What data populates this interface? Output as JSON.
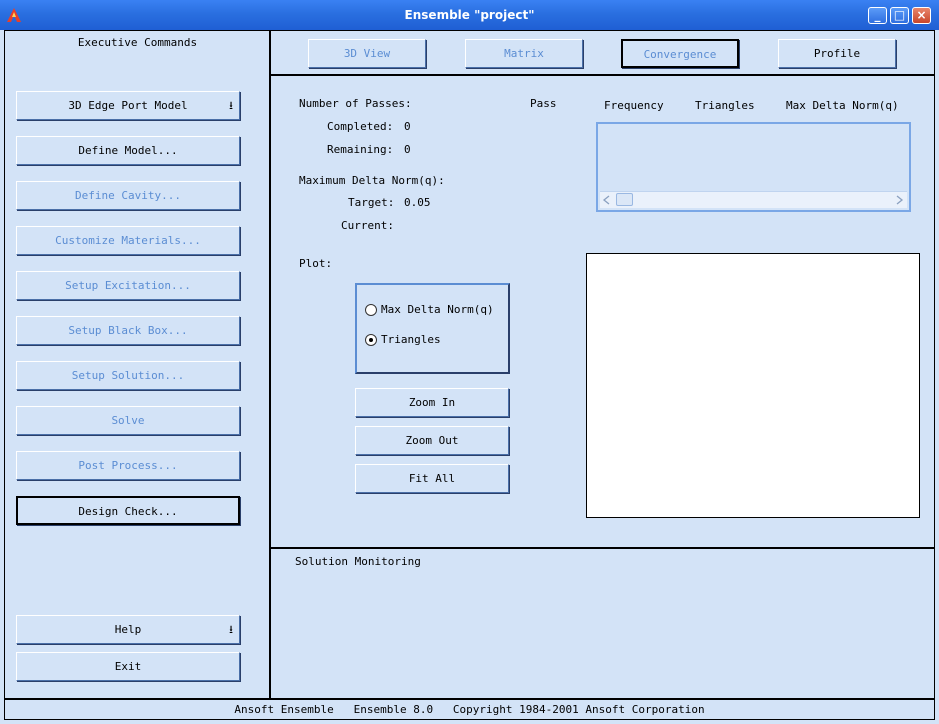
{
  "window": {
    "title": "Ensemble \"project\""
  },
  "left": {
    "title": "Executive Commands",
    "buttons": [
      {
        "label": "3D Edge Port Model",
        "state": "normal",
        "has_arrow": true
      },
      {
        "label": "Define Model...",
        "state": "normal"
      },
      {
        "label": "Define Cavity...",
        "state": "disabled"
      },
      {
        "label": "Customize Materials...",
        "state": "disabled"
      },
      {
        "label": "Setup Excitation...",
        "state": "disabled"
      },
      {
        "label": "Setup Black Box...",
        "state": "disabled"
      },
      {
        "label": "Setup Solution...",
        "state": "disabled"
      },
      {
        "label": "Solve",
        "state": "disabled"
      },
      {
        "label": "Post Process...",
        "state": "disabled"
      },
      {
        "label": "Design Check...",
        "state": "selected"
      }
    ],
    "help": "Help",
    "exit": "Exit",
    "arrow_glyph": "⭳"
  },
  "tabs": [
    {
      "label": "3D View",
      "state": "disabled"
    },
    {
      "label": "Matrix",
      "state": "disabled"
    },
    {
      "label": "Convergence",
      "state": "active"
    },
    {
      "label": "Profile",
      "state": "normal"
    }
  ],
  "convergence": {
    "number_of_passes": "Number of Passes:",
    "completed_label": "Completed:",
    "completed_value": "0",
    "remaining_label": "Remaining:",
    "remaining_value": "0",
    "max_delta_label": "Maximum Delta Norm(q):",
    "target_label": "Target:",
    "target_value": "0.05",
    "current_label": "Current:",
    "columns": [
      "Pass",
      "Frequency",
      "Triangles",
      "Max Delta Norm(q)"
    ],
    "plot_label": "Plot:",
    "plot_options": [
      {
        "label": "Max Delta Norm(q)",
        "selected": false
      },
      {
        "label": "Triangles",
        "selected": true
      }
    ],
    "zoom_in": "Zoom In",
    "zoom_out": "Zoom Out",
    "fit_all": "Fit All"
  },
  "monitor": {
    "title": "Solution Monitoring"
  },
  "status": "Ansoft Ensemble   Ensemble 8.0   Copyright 1984-2001 Ansoft Corporation",
  "colors": {
    "titlebar": "#2a6fe0",
    "panel": "#d3e3f7",
    "disabled_text": "#5b8dd3"
  }
}
